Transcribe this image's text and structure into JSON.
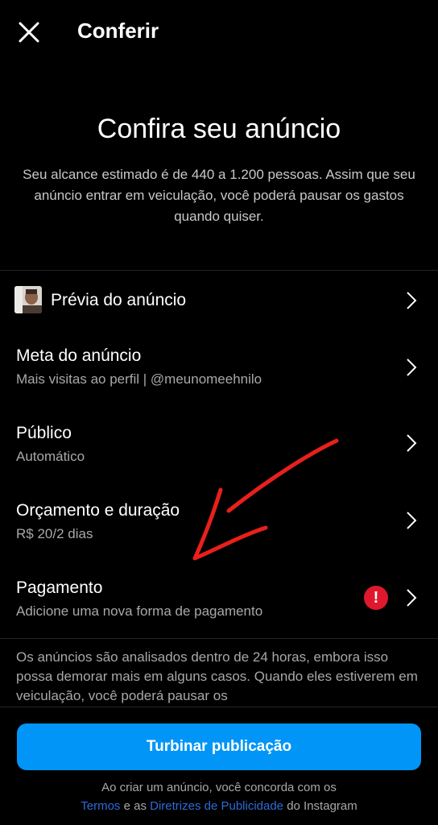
{
  "header": {
    "title": "Conferir",
    "close_icon": "close-icon"
  },
  "hero": {
    "title": "Confira seu anúncio",
    "description": "Seu alcance estimado é de 440 a 1.200 pessoas. Assim que seu anúncio entrar em veiculação, você poderá pausar os gastos quando quiser."
  },
  "rows": [
    {
      "title": "Prévia do anúncio"
    },
    {
      "title": "Meta do anúncio",
      "subtitle": "Mais visitas ao perfil | @meunomeehnilo"
    },
    {
      "title": "Público",
      "subtitle": "Automático"
    },
    {
      "title": "Orçamento e duração",
      "subtitle": "R$ 20/2 dias"
    },
    {
      "title": "Pagamento",
      "subtitle": "Adicione uma nova forma de pagamento",
      "alert": "!"
    }
  ],
  "note": "Os anúncios são analisados dentro de 24 horas, embora isso possa demorar mais em alguns casos. Quando eles estiverem em veiculação, você poderá pausar os",
  "cta_label": "Turbinar publicação",
  "legal": {
    "line1": "Ao criar um anúncio, você concorda com os",
    "terms_link": "Termos",
    "and": " e as ",
    "guidelines_link": "Diretrizes de Publicidade",
    "suffix": " do Instagram"
  },
  "colors": {
    "accent": "#0095f6",
    "alert": "#e0182d",
    "annotation": "#e8201c",
    "link": "#2e6bd6"
  }
}
